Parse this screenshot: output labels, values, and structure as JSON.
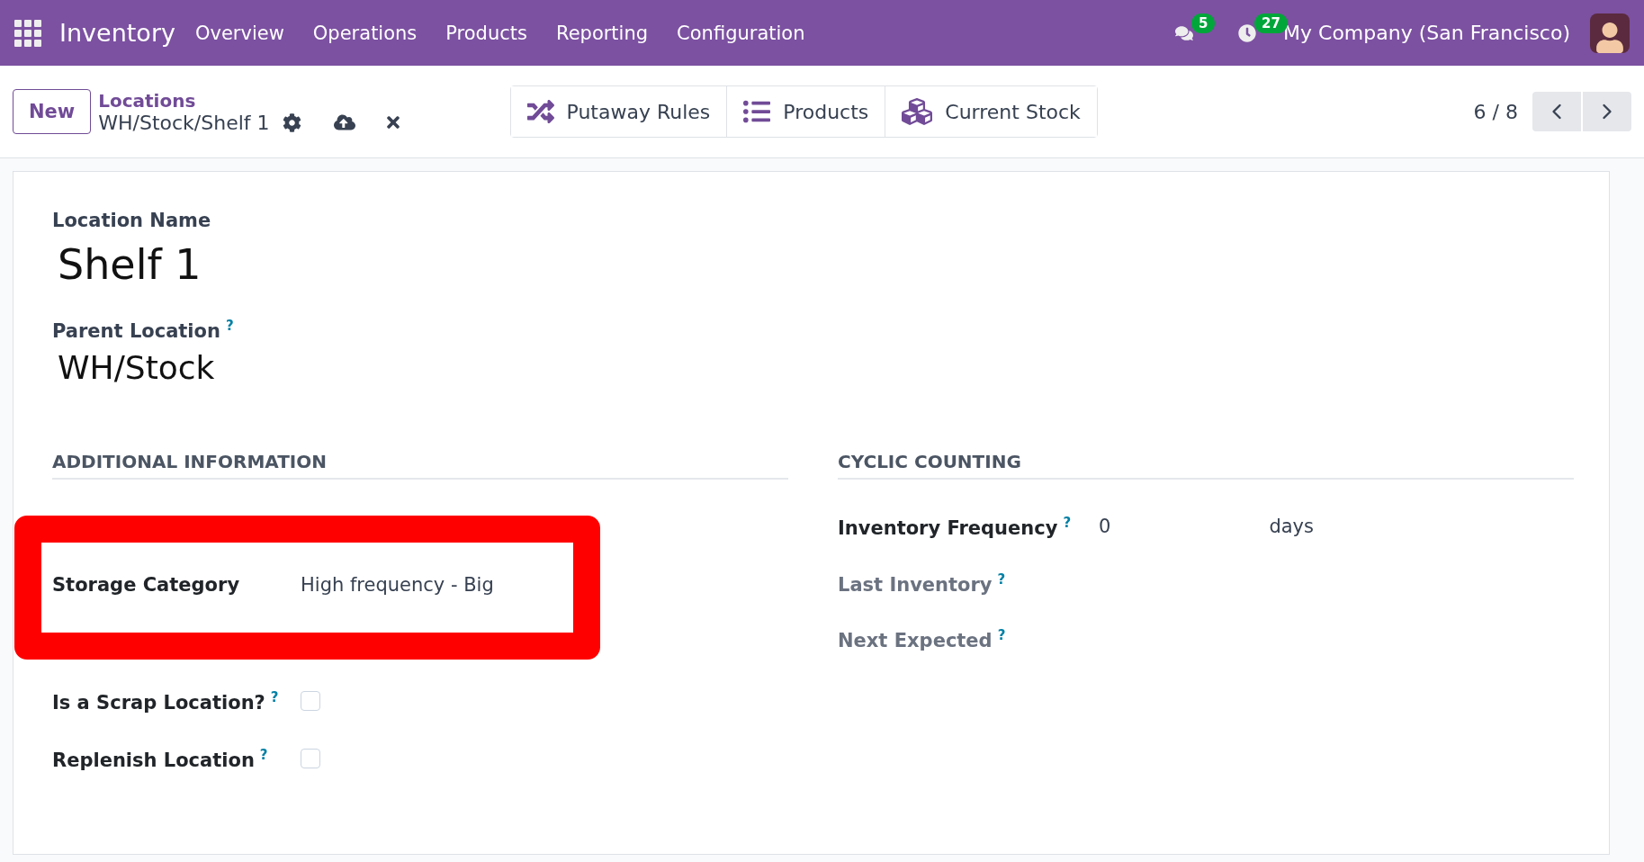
{
  "navbar": {
    "app": "Inventory",
    "menu": [
      "Overview",
      "Operations",
      "Products",
      "Reporting",
      "Configuration"
    ],
    "messages_badge": "5",
    "activities_badge": "27",
    "company": "My Company (San Francisco)"
  },
  "control_panel": {
    "new_button": "New",
    "breadcrumb": "Locations",
    "record": "WH/Stock/Shelf 1",
    "smart_buttons": [
      {
        "kind": "shuffle",
        "label": "Putaway Rules"
      },
      {
        "kind": "list",
        "label": "Products"
      },
      {
        "kind": "cubes",
        "label": "Current Stock"
      }
    ],
    "pager": "6 / 8"
  },
  "form": {
    "name_label": "Location Name",
    "name": "Shelf 1",
    "parent_label": "Parent Location",
    "parent_help": "?",
    "parent": "WH/Stock",
    "sections": [
      {
        "title": "ADDITIONAL INFORMATION",
        "rows": [
          {
            "kind": "covered"
          },
          {
            "kind": "text",
            "label": "Storage Category",
            "value": "High frequency - Big",
            "highlighted": true
          },
          {
            "kind": "covered"
          },
          {
            "kind": "checkbox",
            "label": "Is a Scrap Location?",
            "help": "?",
            "checked": false
          },
          {
            "kind": "checkbox",
            "label": "Replenish Location",
            "help": "?",
            "checked": false
          }
        ]
      },
      {
        "title": "CYCLIC COUNTING",
        "rows": [
          {
            "kind": "number",
            "label": "Inventory Frequency",
            "help": "?",
            "value": "0",
            "unit": "days"
          },
          {
            "kind": "readonly",
            "label": "Last Inventory",
            "help": "?"
          },
          {
            "kind": "readonly",
            "label": "Next Expected",
            "help": "?"
          }
        ]
      }
    ]
  }
}
